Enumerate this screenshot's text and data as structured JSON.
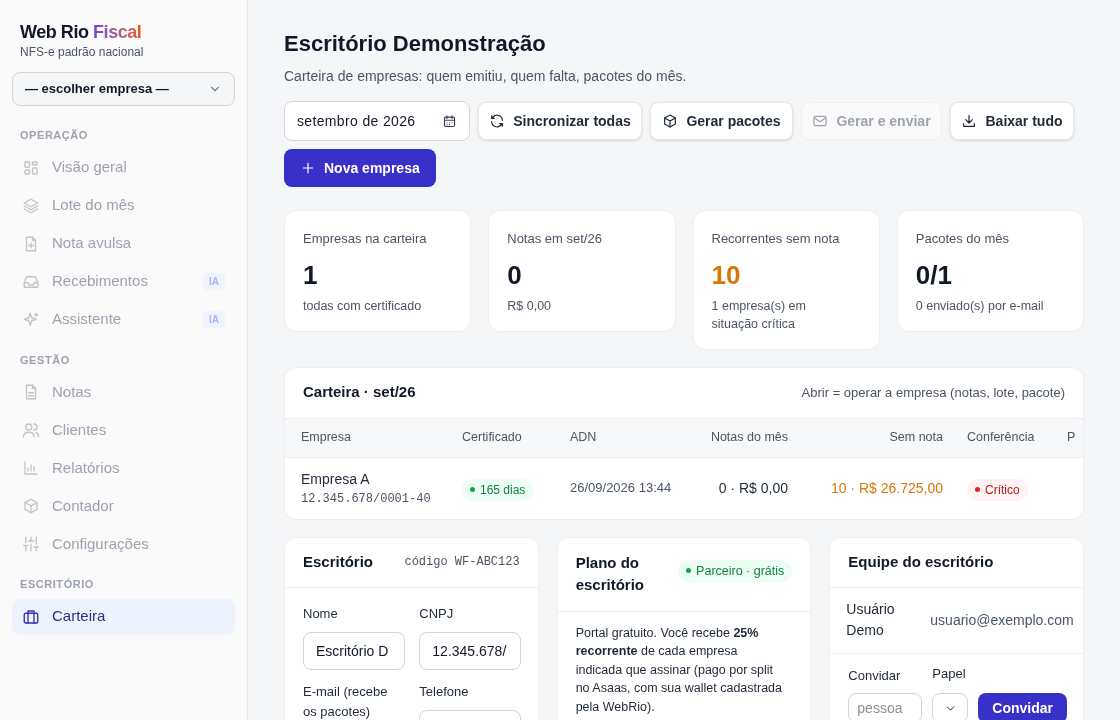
{
  "brand": {
    "name": "Web Rio",
    "accent": "Fiscal",
    "subtitle": "NFS-e padrão nacional"
  },
  "company_select": {
    "value": "— escolher empresa —"
  },
  "sidebar": {
    "sections": [
      {
        "title": "OPERAÇÃO",
        "items": [
          {
            "label": "Visão geral",
            "selected": false
          },
          {
            "label": "Lote do mês",
            "selected": false
          },
          {
            "label": "Nota avulsa",
            "selected": false
          },
          {
            "label": "Recebimentos",
            "selected": false,
            "badge": "IA"
          },
          {
            "label": "Assistente",
            "selected": false,
            "badge": "IA"
          }
        ]
      },
      {
        "title": "GESTÃO",
        "items": [
          {
            "label": "Notas",
            "selected": false
          },
          {
            "label": "Clientes",
            "selected": false
          },
          {
            "label": "Relatórios",
            "selected": false
          },
          {
            "label": "Contador",
            "selected": false
          },
          {
            "label": "Configurações",
            "selected": false
          }
        ]
      },
      {
        "title": "ESCRITÓRIO",
        "items": [
          {
            "label": "Carteira",
            "selected": true
          }
        ]
      }
    ]
  },
  "header": {
    "title": "Escritório Demonstração",
    "subtitle": "Carteira de empresas: quem emitiu, quem falta, pacotes do mês."
  },
  "toolbar": {
    "month": "setembro de 2026",
    "buttons": [
      {
        "label": "Sincronizar todas",
        "disabled": false
      },
      {
        "label": "Gerar pacotes",
        "disabled": false
      },
      {
        "label": "Gerar e enviar",
        "disabled": true
      },
      {
        "label": "Baixar tudo",
        "disabled": false
      }
    ],
    "primary": "Nova empresa"
  },
  "stats": [
    {
      "label": "Empresas na carteira",
      "value": "1",
      "note": "todas com certificado",
      "warning": false
    },
    {
      "label": "Notas em set/26",
      "value": "0",
      "note": "R$ 0,00",
      "warning": false
    },
    {
      "label": "Recorrentes sem nota",
      "value": "10",
      "note": "1 empresa(s) em situação crítica",
      "warning": true
    },
    {
      "label": "Pacotes do mês",
      "value": "0/1",
      "note": "0 enviado(s) por e-mail",
      "warning": false
    }
  ],
  "table": {
    "title": "Carteira · set/26",
    "hint": "Abrir = operar a empresa (notas, lote, pacote)",
    "columns": [
      "Empresa",
      "Certificado",
      "ADN",
      "Notas do mês",
      "Sem nota",
      "Conferência",
      "P"
    ],
    "rows": [
      {
        "name": "Empresa A",
        "cnpj": "12.345.678/0001-40",
        "certificate": "165 dias",
        "adn": "26/09/2026 13:44",
        "notes": "0 · R$ 0,00",
        "missing": "10 · R$ 26.725,00",
        "status": "Crítico",
        "critical": true
      }
    ]
  },
  "office": {
    "title": "Escritório",
    "code": "código WF-ABC123",
    "fields": [
      {
        "label": "Nome",
        "kind": "input",
        "value": "Escritório D"
      },
      {
        "label": "CNPJ",
        "kind": "input",
        "value": "12.345.678/"
      },
      {
        "label": "E-mail (recebe os pacotes)",
        "kind": "label"
      },
      {
        "label": "Telefone",
        "kind": "input"
      }
    ]
  },
  "plan": {
    "title": "Plano do escritório",
    "badge": "Parceiro · grátis",
    "text": "Portal gratuito. Você recebe **25% recorrente** de cada empresa indicada que assinar (pago por split no Asaas, com sua wallet cadastrada pela WebRio)."
  },
  "team": {
    "title": "Equipe do escritório",
    "members": [
      {
        "name": "Usuário Demo",
        "email": "usuario@exemplo.com"
      }
    ],
    "invite": {
      "label": "Convidar",
      "placeholder": "pessoa",
      "role_label": "Papel",
      "button": "Convidar"
    }
  }
}
